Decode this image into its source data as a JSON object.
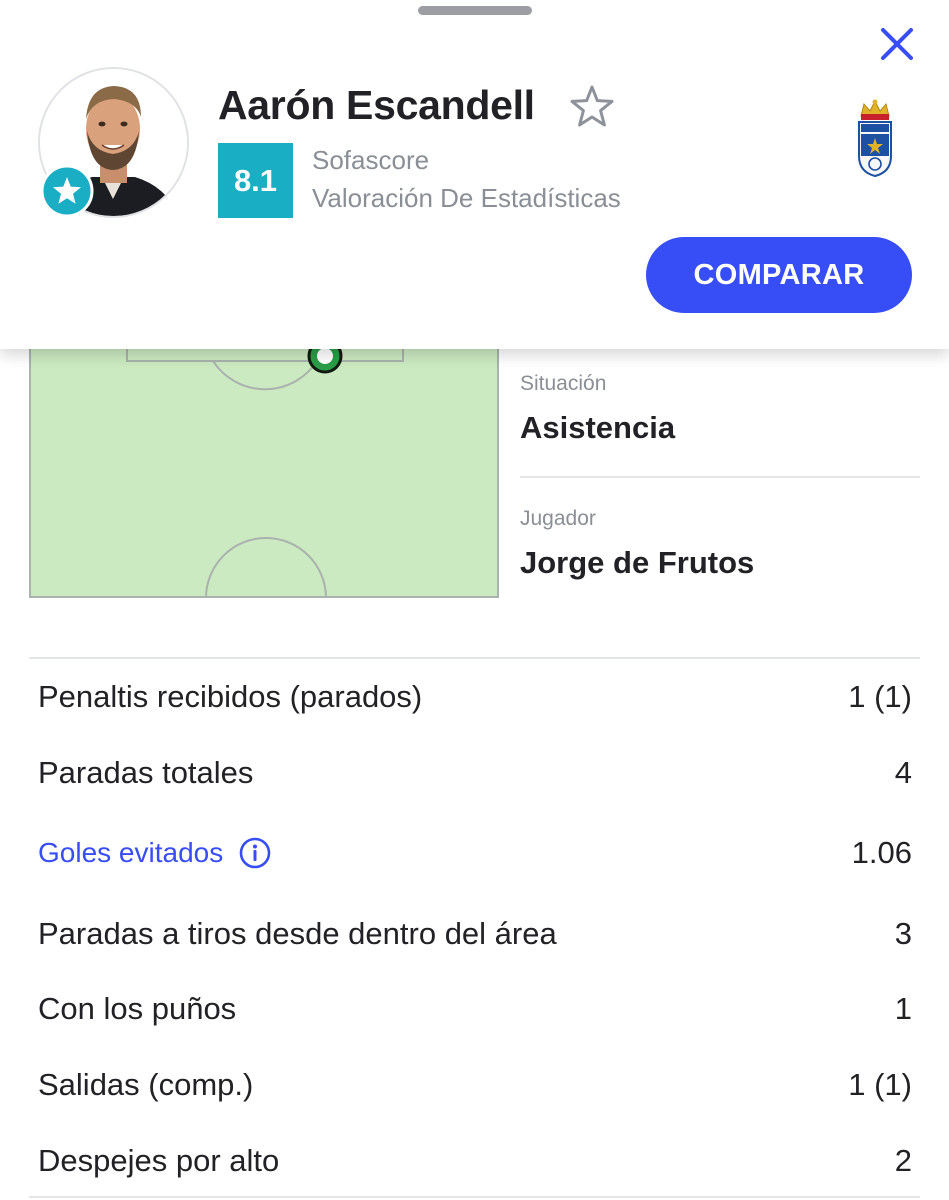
{
  "header": {
    "player_name": "Aarón Escandell",
    "rating": "8.1",
    "rating_source": "Sofascore",
    "rating_type": "Valoración De Estadísticas",
    "compare_label": "COMPARAR"
  },
  "event": {
    "situation_label": "Situación",
    "situation_value": "Asistencia",
    "player_label": "Jugador",
    "player_value": "Jorge de Frutos"
  },
  "stats": [
    {
      "label": "Penaltis recibidos (parados)",
      "value": "1 (1)"
    },
    {
      "label": "Paradas totales",
      "value": "4"
    },
    {
      "label": "Goles evitados",
      "value": "1.06"
    },
    {
      "label": "Paradas a tiros desde dentro del área",
      "value": "3"
    },
    {
      "label": "Con los puños",
      "value": "1"
    },
    {
      "label": "Salidas (comp.)",
      "value": "1 (1)"
    },
    {
      "label": "Despejes por alto",
      "value": "2"
    }
  ],
  "colors": {
    "accent": "#374df5",
    "rating": "#1aaec5",
    "pitch": "#cbeac1"
  },
  "icons": [
    "close-icon",
    "star-outline-icon",
    "star-badge-icon",
    "info-icon",
    "club-crest-icon"
  ]
}
